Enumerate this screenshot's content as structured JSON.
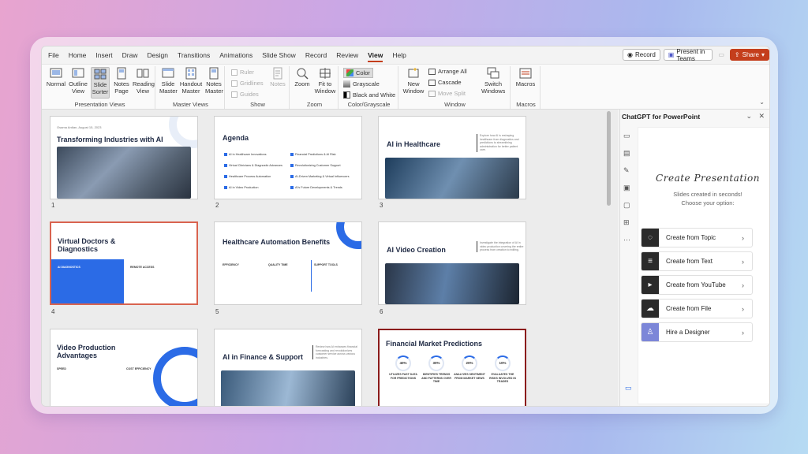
{
  "menu": {
    "items": [
      "File",
      "Home",
      "Insert",
      "Draw",
      "Design",
      "Transitions",
      "Animations",
      "Slide Show",
      "Record",
      "Review",
      "View",
      "Help"
    ],
    "active": "View"
  },
  "top_right": {
    "record": "Record",
    "teams": "Present in Teams",
    "share": "Share"
  },
  "ribbon": {
    "presentation_views": {
      "label": "Presentation Views",
      "buttons": [
        "Normal",
        "Outline View",
        "Slide Sorter",
        "Notes Page",
        "Reading View"
      ]
    },
    "master_views": {
      "label": "Master Views",
      "buttons": [
        "Slide Master",
        "Handout Master",
        "Notes Master"
      ]
    },
    "show": {
      "label": "Show",
      "ruler": "Ruler",
      "gridlines": "Gridlines",
      "guides": "Guides",
      "notes": "Notes"
    },
    "zoom": {
      "label": "Zoom",
      "zoom": "Zoom",
      "fit": "Fit to Window"
    },
    "color": {
      "label": "Color/Grayscale",
      "color": "Color",
      "grayscale": "Grayscale",
      "bw": "Black and White"
    },
    "window": {
      "label": "Window",
      "new": "New Window",
      "arrange": "Arrange All",
      "cascade": "Cascade",
      "move": "Move Split",
      "switch": "Switch Windows"
    },
    "macros": {
      "label": "Macros",
      "macros": "Macros"
    }
  },
  "slides": [
    {
      "num": "1",
      "title": "Transforming Industries with AI",
      "meta": "Osama Ardian, August 15, 2023"
    },
    {
      "num": "2",
      "title": "Agenda",
      "items": [
        "AI in Healthcare Innovations",
        "Virtual Clinicians & Diagnostic Advances",
        "Healthcare Process Automation",
        "AI in Video Production",
        "Financial Predictions & AI Risk",
        "Revolutionizing Customer Support",
        "AI-Driven Marketing & Virtual Influencers",
        "AI's Future Developments & Trends"
      ]
    },
    {
      "num": "3",
      "title": "AI in Healthcare",
      "desc": "Explore how AI is reshaping healthcare from diagnostics and predictions to streamlining administration for better patient care."
    },
    {
      "num": "4",
      "title": "Virtual Doctors & Diagnostics",
      "band": "AI DIAGNOSTICS",
      "right": "REMOTE ACCESS"
    },
    {
      "num": "5",
      "title": "Healthcare Automation Benefits",
      "cols": [
        "EFFICIENCY",
        "QUALITY TIME",
        "SUPPORT TOOLS"
      ]
    },
    {
      "num": "6",
      "title": "AI Video Creation",
      "desc": "Investigate the integration of AI in video production covering the entire process from creation to editing."
    },
    {
      "num": "",
      "title": "Video Production Advantages",
      "cols": [
        "SPEED",
        "COST EFFICIENCY"
      ]
    },
    {
      "num": "",
      "title": "AI in Finance & Support",
      "desc": "Review how AI enhances financial forecasting and revolutionizes customer service across various industries."
    },
    {
      "num": "",
      "title": "Financial Market Predictions",
      "stats": [
        {
          "pct": "40%",
          "label": "UTILIZES PAST DATA FOR PREDICTIONS"
        },
        {
          "pct": "30%",
          "label": "IDENTIFIES TRENDS AND PATTERNS OVER TIME"
        },
        {
          "pct": "20%",
          "label": "ANALYZES SENTIMENT FROM MARKET NEWS"
        },
        {
          "pct": "10%",
          "label": "EVALUATES THE RISKS INVOLVED IN TRADES"
        }
      ]
    }
  ],
  "panel": {
    "title": "ChatGPT for PowerPoint",
    "heading": "Create Presentation",
    "sub1": "Slides created in seconds!",
    "sub2": "Choose your option:",
    "options": [
      {
        "label": "Create from Topic",
        "color": "#2b2b2b",
        "icon": "bulb-icon"
      },
      {
        "label": "Create from Text",
        "color": "#2b2b2b",
        "icon": "text-lines-icon"
      },
      {
        "label": "Create from YouTube",
        "color": "#2b2b2b",
        "icon": "play-icon"
      },
      {
        "label": "Create from File",
        "color": "#2b2b2b",
        "icon": "upload-cloud-icon"
      },
      {
        "label": "Hire a Designer",
        "color": "#7c86d8",
        "icon": "designer-icon"
      }
    ]
  },
  "colors": {
    "accent": "#c43e1c",
    "slide_blue": "#2b6be6",
    "selected_slide": "#d9634f"
  }
}
